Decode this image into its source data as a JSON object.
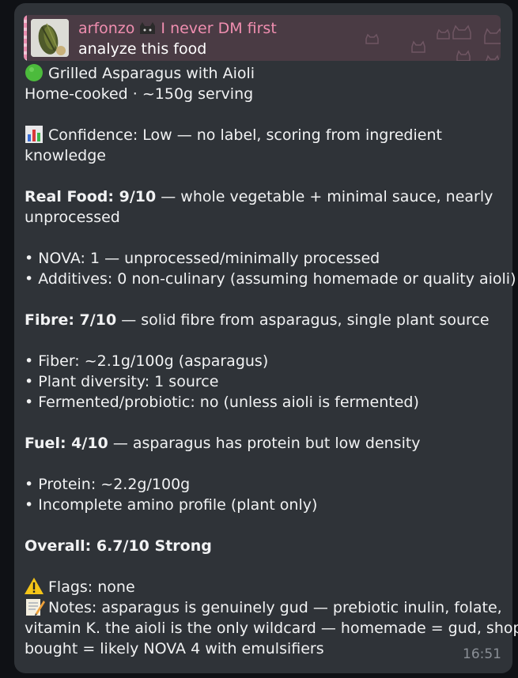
{
  "reply": {
    "author": "arfonzo",
    "author_status": "I never DM first",
    "text": "analyze this food"
  },
  "message": {
    "title": "Grilled Asparagus with Aioli",
    "subtitle": "Home-cooked · ~150g serving",
    "confidence": "Confidence: Low — no label, scoring from ingredient",
    "confidence_cont": "knowledge",
    "real_food_label": "Real Food: 9/10",
    "real_food_text": " — whole vegetable + minimal sauce, nearly",
    "real_food_cont": "unprocessed",
    "nova": "• NOVA: 1 — unprocessed/minimally processed",
    "additives": "• Additives: 0 non-culinary (assuming homemade or quality aioli)",
    "fibre_label": "Fibre: 7/10",
    "fibre_text": " — solid fibre from asparagus, single plant source",
    "fiber_detail": "• Fiber: ~2.1g/100g (asparagus)",
    "plant_diversity": "• Plant diversity: 1 source",
    "fermented": "• Fermented/probiotic: no (unless aioli is fermented)",
    "fuel_label": "Fuel: 4/10",
    "fuel_text": " — asparagus has protein but low density",
    "protein": "• Protein: ~2.2g/100g",
    "amino": "• Incomplete amino profile (plant only)",
    "overall": "Overall: 6.7/10 Strong",
    "flags": "Flags: none",
    "notes_1": "Notes: asparagus is genuinely gud — prebiotic inulin, folate,",
    "notes_2": "vitamin K. the aioli is the only wildcard — homemade = gud, shop-",
    "notes_3": "bought = likely NOVA 4 with emulsifiers",
    "timestamp": "16:51"
  },
  "icons": {
    "title": "green-circle-icon",
    "confidence": "bar-chart-icon",
    "flags": "warning-icon",
    "notes": "memo-icon"
  },
  "colors": {
    "bubble": "#2f3338",
    "reply_bg": "#4a3b44",
    "reply_name": "#f08eb0",
    "text": "#f1f2f3",
    "timestamp": "#8a8f96"
  }
}
